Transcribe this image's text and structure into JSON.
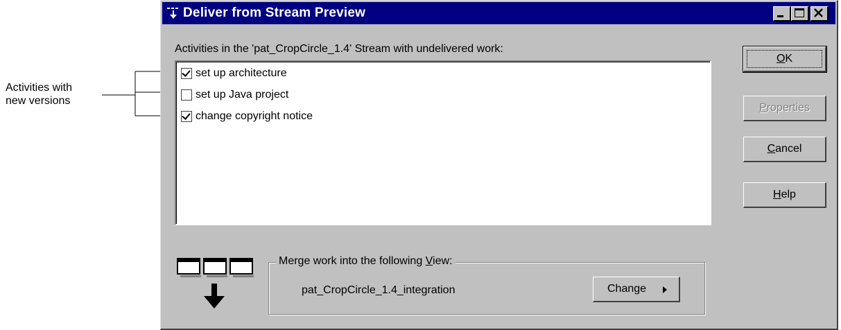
{
  "callout": {
    "text_line1": "Activities with",
    "text_line2": "new versions"
  },
  "window": {
    "title": "Deliver from Stream Preview",
    "title_icon": "stream-icon",
    "controls": [
      "minimize-icon",
      "maximize-icon",
      "close-icon"
    ]
  },
  "activities": {
    "label": "Activities in the 'pat_CropCircle_1.4' Stream with undelivered work:",
    "items": [
      {
        "label": "set up architecture",
        "checked": true
      },
      {
        "label": "set up Java project",
        "checked": false
      },
      {
        "label": "change copyright notice",
        "checked": true
      }
    ]
  },
  "buttons": {
    "ok": {
      "pre": "",
      "accel": "O",
      "post": "K"
    },
    "properties": {
      "pre": "",
      "accel": "P",
      "post": "roperties",
      "disabled": true
    },
    "cancel": {
      "pre": "",
      "accel": "C",
      "post": "ancel"
    },
    "help": {
      "pre": "",
      "accel": "H",
      "post": "elp"
    }
  },
  "merge": {
    "legend_pre": "Merge work into the following ",
    "legend_accel": "V",
    "legend_post": "iew:",
    "view_name": "pat_CropCircle_1.4_integration",
    "change_label": "Change",
    "graphic_icon": "merge-views-icon"
  },
  "colors": {
    "titlebar": "#000080",
    "face": "#c0c0c0"
  }
}
